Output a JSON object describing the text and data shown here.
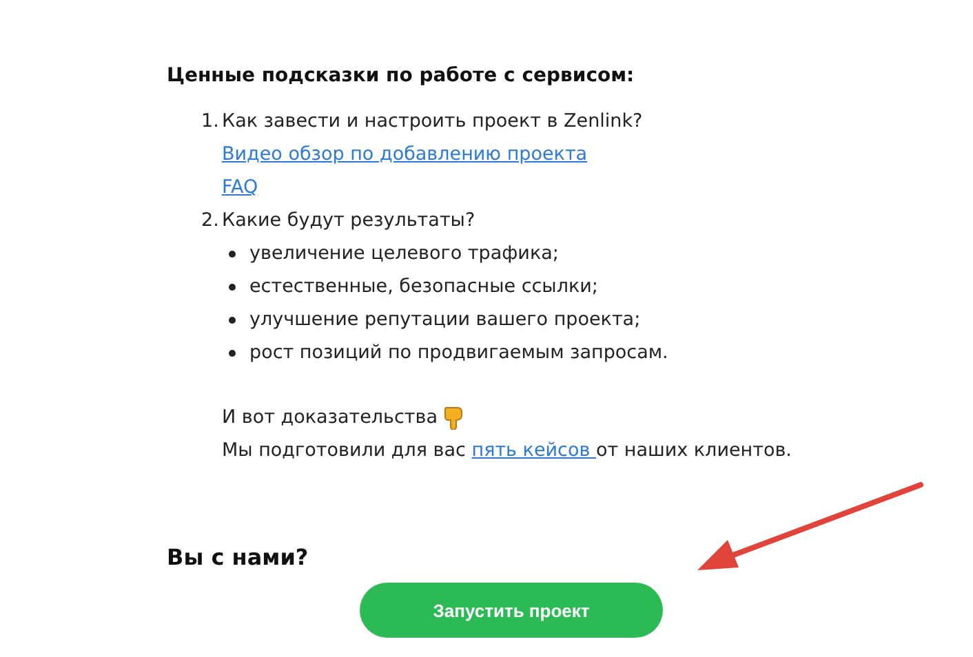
{
  "heading": "Ценные подсказки по работе с сервисом:",
  "steps": [
    {
      "number": "1.",
      "text": "Как завести и настроить проект в Zenlink?",
      "links": [
        "Видео обзор по добавлению проекта",
        "FAQ"
      ]
    },
    {
      "number": "2.",
      "text": "Какие будут результаты?",
      "bullets": [
        "увеличение целевого трафика;",
        "естественные, безопасные ссылки;",
        "улучшение репутации вашего проекта;",
        "рост позиций по продвигаемым запросам."
      ]
    }
  ],
  "proof": {
    "text": "И вот доказательства"
  },
  "cases": {
    "before": "Мы подготовили для вас ",
    "link": "пять кейсов ",
    "after": "от наших клиентов."
  },
  "cta": {
    "question": "Вы с нами?",
    "button": "Запустить проект"
  }
}
